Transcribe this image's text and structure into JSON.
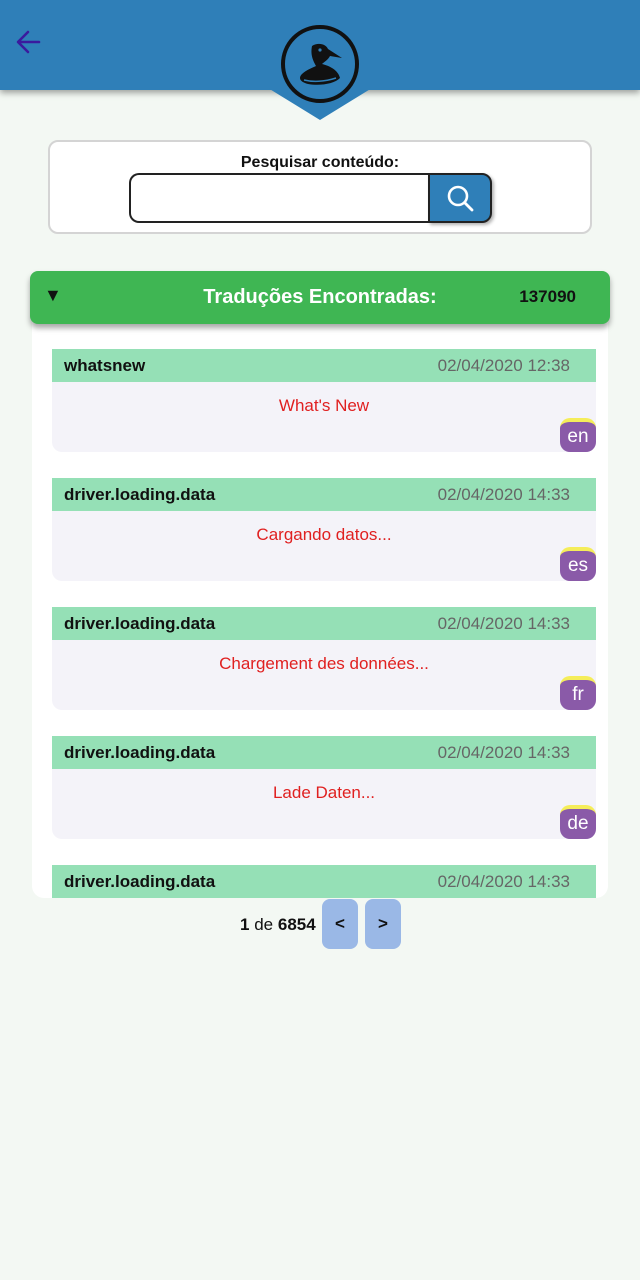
{
  "header": {
    "back_icon": "arrow-left-icon",
    "logo_icon": "pelican-icon"
  },
  "search": {
    "label": "Pesquisar conteúdo:",
    "value": "",
    "placeholder": "",
    "button_icon": "search-icon"
  },
  "results": {
    "title": "Traduções Encontradas:",
    "count": "137090",
    "toggle_icon": "triangle-down-icon",
    "items": [
      {
        "key": "whatsnew",
        "date": "02/04/2020 12:38",
        "text": "What's New",
        "lang": "en"
      },
      {
        "key": "driver.loading.data",
        "date": "02/04/2020 14:33",
        "text": "Cargando datos...",
        "lang": "es"
      },
      {
        "key": "driver.loading.data",
        "date": "02/04/2020 14:33",
        "text": "Chargement des données...",
        "lang": "fr"
      },
      {
        "key": "driver.loading.data",
        "date": "02/04/2020 14:33",
        "text": "Lade Daten...",
        "lang": "de"
      },
      {
        "key": "driver.loading.data",
        "date": "02/04/2020 14:33",
        "text": "",
        "lang": ""
      }
    ]
  },
  "pagination": {
    "current": "1",
    "of_label": "de",
    "total": "6854",
    "prev_label": "<",
    "next_label": ">"
  },
  "colors": {
    "header": "#2f7fb8",
    "results_bar": "#3fb653",
    "item_head": "#95e0b6",
    "item_text": "#e02020",
    "badge": "#8a5aa8",
    "badge_top": "#f5ed5a",
    "page_btn": "#9ab8e6"
  }
}
